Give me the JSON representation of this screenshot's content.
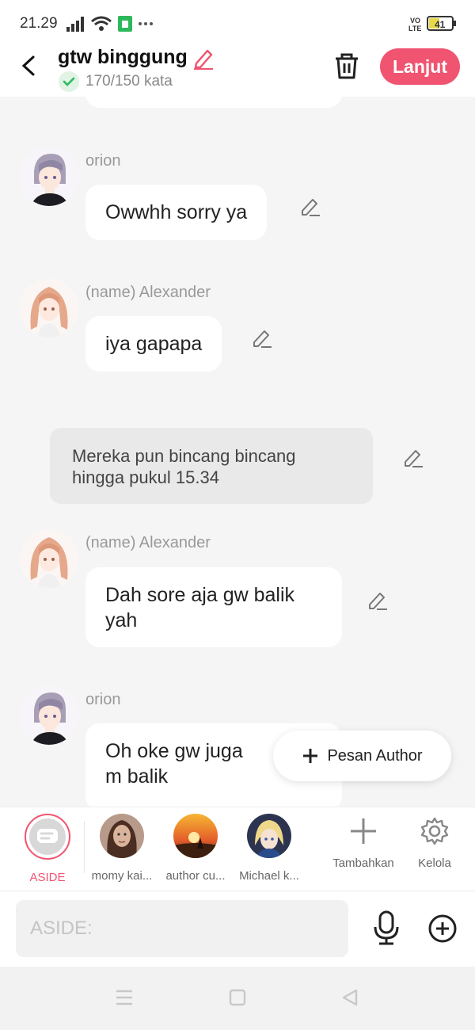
{
  "status_bar": {
    "time": "21.29",
    "lte": "VO LTE",
    "battery": "41"
  },
  "header": {
    "title": "gtw binggung",
    "word_count": "170/150 kata",
    "next_label": "Lanjut"
  },
  "chat": {
    "messages": [
      {
        "type": "dialog",
        "speaker": "orion",
        "text": "Owwhh sorry ya"
      },
      {
        "type": "dialog",
        "speaker": "(name) Alexander",
        "text": "iya gapapa"
      },
      {
        "type": "narration",
        "text": "Mereka pun bincang bincang hingga pukul 15.34"
      },
      {
        "type": "dialog",
        "speaker": "(name) Alexander",
        "text": "Dah sore aja gw balik yah"
      },
      {
        "type": "dialog",
        "speaker": "orion",
        "text": "Oh oke gw juga m balik"
      }
    ],
    "fab_label": "Pesan Author"
  },
  "characters": [
    {
      "label": "ASIDE",
      "selected": true
    },
    {
      "label": "momy kai..."
    },
    {
      "label": "author cu..."
    },
    {
      "label": "Michael k..."
    }
  ],
  "actions": {
    "add_label": "Tambahkan",
    "manage_label": "Kelola"
  },
  "input": {
    "placeholder": "ASIDE:"
  },
  "colors": {
    "accent": "#f05470",
    "check": "#2eb85c",
    "background": "#f5f5f5"
  }
}
